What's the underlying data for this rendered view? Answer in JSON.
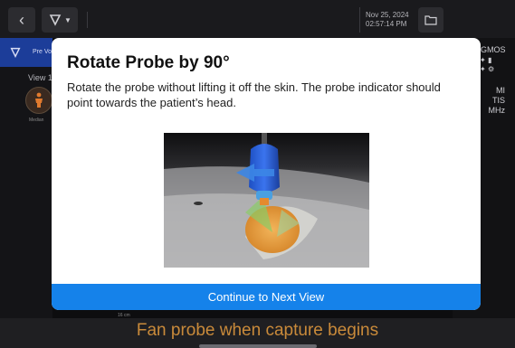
{
  "topbar": {
    "back_icon": "chevron-left-icon",
    "probe_icon": "probe-icon",
    "date": "Nov 25, 2024",
    "time": "02:57:14 PM",
    "folder_icon": "folder-icon"
  },
  "left_panel": {
    "preview_label": "Pre Vo",
    "view_label": "View 1",
    "view_caption": "Median"
  },
  "right_panel": {
    "sensor_label": "GMOS",
    "readout": [
      "MI",
      "TIS",
      "MHz"
    ]
  },
  "modal": {
    "title": "Rotate Probe by 90°",
    "body": "Rotate the probe without lifting it off the skin. The probe indicator should point towards the patient’s head.",
    "continue_label": "Continue to Next View",
    "accent": "#1582ea"
  },
  "depth_label": "16 cm",
  "bottom": {
    "instruction": "Fan probe when capture begins",
    "instruction_color": "#c98a3a"
  }
}
